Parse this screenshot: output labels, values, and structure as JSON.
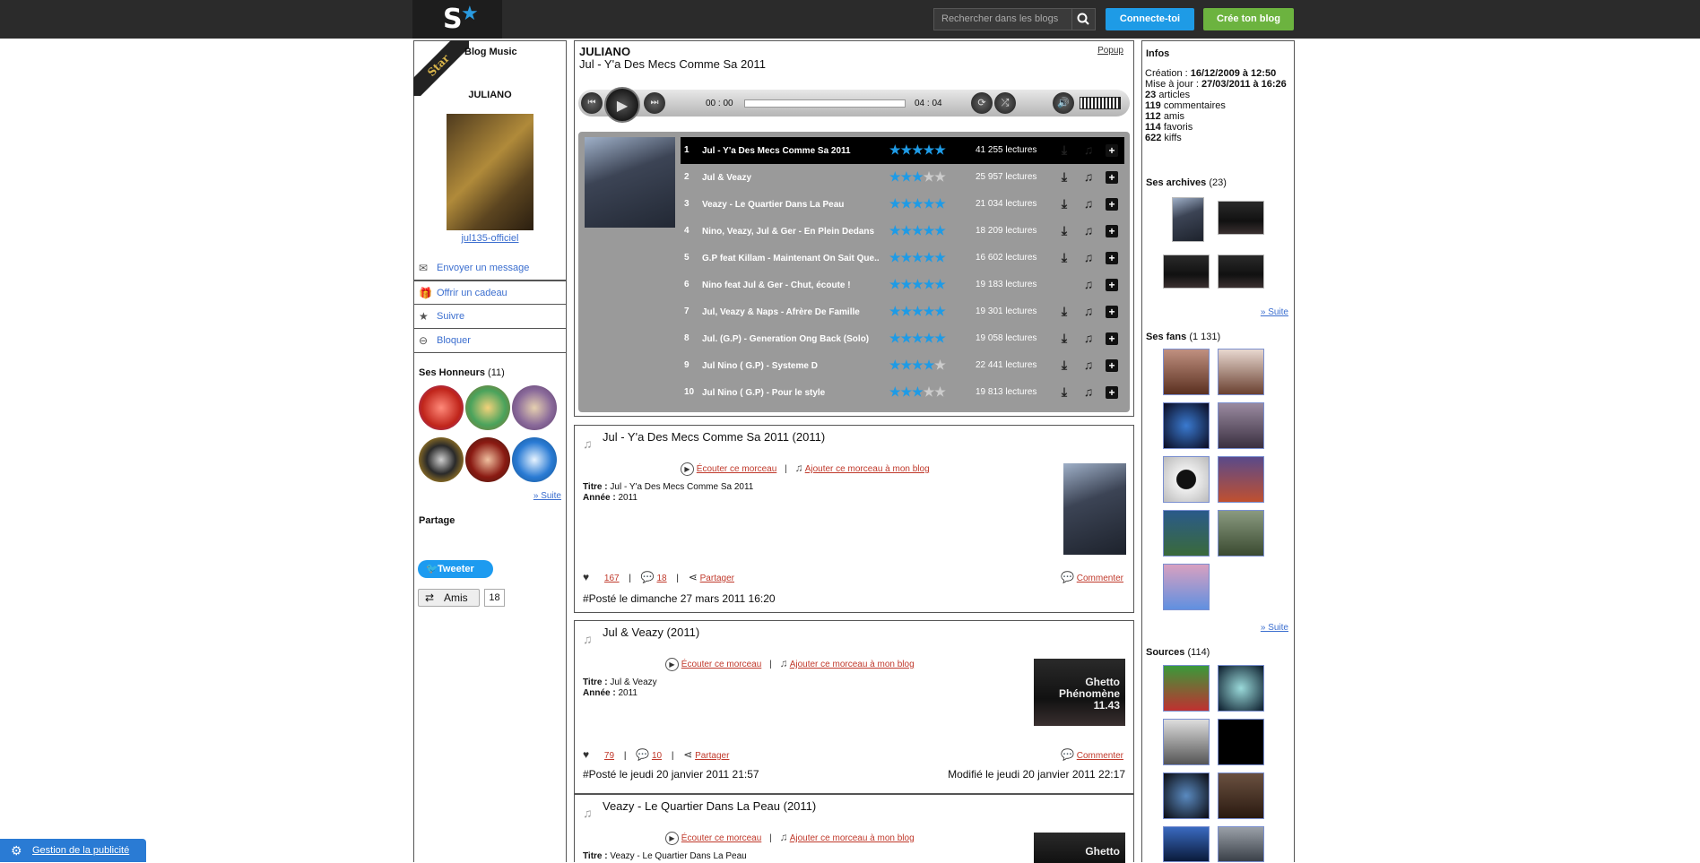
{
  "header": {
    "logo_letter": "S",
    "search_placeholder": "Rechercher dans les blogs",
    "login_label": "Connecte-toi",
    "create_label": "Crée ton blog"
  },
  "left": {
    "ribbon": "Star",
    "blog_type": "Blog Music",
    "blog_name": "JULIANO",
    "username": "jul135-officiel",
    "actions": [
      "Envoyer un message",
      "Offrir un cadeau",
      "Suivre",
      "Bloquer"
    ],
    "honneurs_label": "Ses Honneurs",
    "honneurs_count": "(11)",
    "suite": "» Suite",
    "partage": "Partage",
    "tweet": "Tweeter",
    "amis": "Amis",
    "amis_count": "18"
  },
  "player": {
    "title": "JULIANO",
    "subtitle": "Jul - Y'a Des Mecs Comme Sa 2011",
    "popup": "Popup",
    "time_current": "00 : 00",
    "time_total": "04 : 04",
    "tracks": [
      {
        "n": "1",
        "title": "Jul - Y'a Des Mecs Comme Sa 2011",
        "stars": 5,
        "listens": "41 255 lectures"
      },
      {
        "n": "2",
        "title": "Jul & Veazy",
        "stars": 3,
        "listens": "25 957 lectures"
      },
      {
        "n": "3",
        "title": "Veazy - Le Quartier Dans La Peau",
        "stars": 5,
        "listens": "21 034 lectures"
      },
      {
        "n": "4",
        "title": "Nino, Veazy, Jul & Ger - En Plein Dedans",
        "stars": 5,
        "listens": "18 209 lectures"
      },
      {
        "n": "5",
        "title": "G.P feat Killam - Maintenant On Sait Que..",
        "stars": 5,
        "listens": "16 602 lectures"
      },
      {
        "n": "6",
        "title": "Nino feat Jul & Ger - Chut, écoute !",
        "stars": 5,
        "listens": "19 183 lectures"
      },
      {
        "n": "7",
        "title": "Jul, Veazy & Naps - Afrère De Famille",
        "stars": 5,
        "listens": "19 301 lectures"
      },
      {
        "n": "8",
        "title": "Jul. (G.P) - Generation Ong Back (Solo)",
        "stars": 5,
        "listens": "19 058 lectures"
      },
      {
        "n": "9",
        "title": "Jul Nino ( G.P) - Systeme D",
        "stars": 4,
        "listens": "22 441 lectures"
      },
      {
        "n": "10",
        "title": "Jul Nino ( G.P) - Pour le style",
        "stars": 3,
        "listens": "19 813 lectures"
      }
    ]
  },
  "articles": [
    {
      "title": "Jul - Y'a Des Mecs Comme Sa 2011 (2011)",
      "listen": "Écouter ce morceau",
      "add": "Ajouter ce morceau à mon blog",
      "titre_label": "Titre :",
      "titre": "Jul - Y'a Des Mecs Comme Sa 2011",
      "annee_label": "Année :",
      "annee": "2011",
      "likes": "167",
      "comments": "18",
      "share": "Partager",
      "comment_label": "Commenter",
      "posted": "#Posté le dimanche 27 mars 2011 16:20",
      "modified": ""
    },
    {
      "title": "Jul & Veazy (2011)",
      "listen": "Écouter ce morceau",
      "add": "Ajouter ce morceau à mon blog",
      "titre_label": "Titre :",
      "titre": "Jul & Veazy",
      "annee_label": "Année :",
      "annee": "2011",
      "likes": "79",
      "comments": "10",
      "share": "Partager",
      "comment_label": "Commenter",
      "posted": "#Posté le jeudi 20 janvier 2011 21:57",
      "modified": "Modifié le jeudi 20 janvier 2011 22:17",
      "thumb_text": "Ghetto Phénomène 11.43"
    },
    {
      "title": "Veazy - Le Quartier Dans La Peau (2011)",
      "listen": "Écouter ce morceau",
      "add": "Ajouter ce morceau à mon blog",
      "titre_label": "Titre :",
      "titre": "Veazy - Le Quartier Dans La Peau",
      "thumb_text": "Ghetto"
    }
  ],
  "right": {
    "infos_title": "Infos",
    "creation_label": "Création :",
    "creation": "16/12/2009 à 12:50",
    "maj_label": "Mise à jour :",
    "maj": "27/03/2011 à 16:26",
    "stats": [
      {
        "n": "23",
        "l": "articles"
      },
      {
        "n": "119",
        "l": "commentaires"
      },
      {
        "n": "112",
        "l": "amis"
      },
      {
        "n": "114",
        "l": "favoris"
      },
      {
        "n": "622",
        "l": "kiffs"
      }
    ],
    "archives_label": "Ses archives",
    "archives_count": "(23)",
    "fans_label": "Ses fans",
    "fans_count": "(1 131)",
    "sources_label": "Sources",
    "sources_count": "(114)",
    "suite": "» Suite"
  },
  "footer": {
    "gestion": "Gestion de la publicité"
  },
  "colors": {
    "accent_blue": "#1e9be6",
    "green": "#6cb33f",
    "link_red": "#c0392b"
  }
}
